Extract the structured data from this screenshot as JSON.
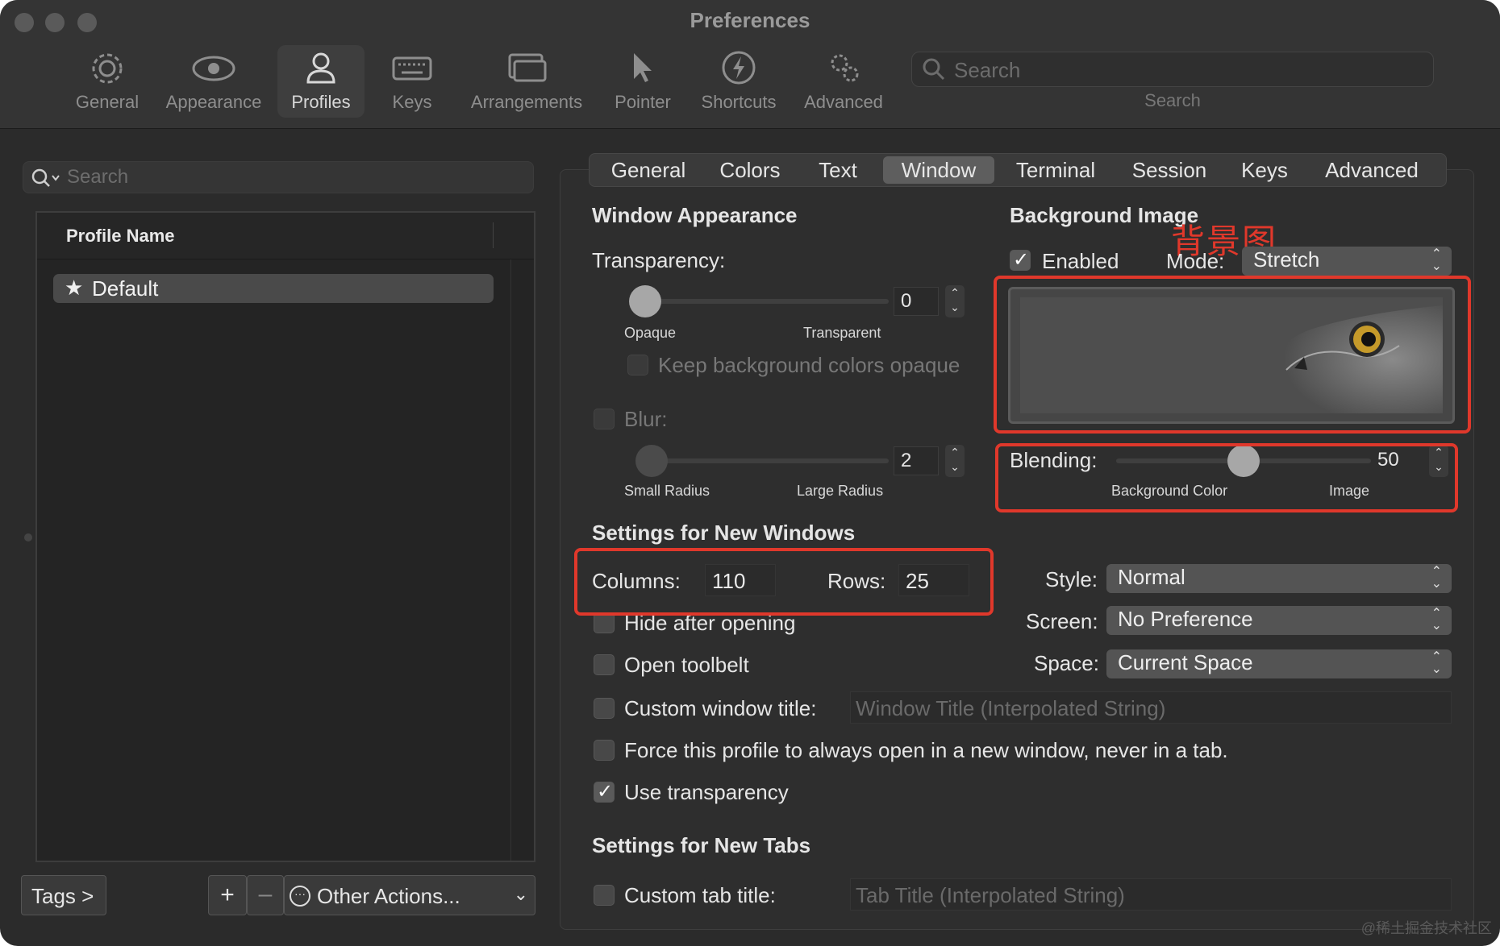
{
  "window": {
    "title": "Preferences"
  },
  "toolbar": {
    "items": [
      {
        "label": "General",
        "icon": "gear-icon"
      },
      {
        "label": "Appearance",
        "icon": "eye-icon"
      },
      {
        "label": "Profiles",
        "icon": "person-icon",
        "active": true
      },
      {
        "label": "Keys",
        "icon": "keyboard-icon"
      },
      {
        "label": "Arrangements",
        "icon": "windows-icon"
      },
      {
        "label": "Pointer",
        "icon": "pointer-icon"
      },
      {
        "label": "Shortcuts",
        "icon": "bolt-icon"
      },
      {
        "label": "Advanced",
        "icon": "gears-icon"
      }
    ],
    "search_placeholder": "Search",
    "search_label": "Search"
  },
  "profiles": {
    "search_placeholder": "Search",
    "column_header": "Profile Name",
    "items": [
      {
        "name": "Default",
        "icon": "star-icon",
        "selected": true
      }
    ],
    "tags_button": "Tags >",
    "add_button": "+",
    "remove_button": "–",
    "other_actions": "Other Actions..."
  },
  "tabs": [
    "General",
    "Colors",
    "Text",
    "Window",
    "Terminal",
    "Session",
    "Keys",
    "Advanced"
  ],
  "active_tab": "Window",
  "window_appearance": {
    "heading": "Window Appearance",
    "transparency_label": "Transparency:",
    "transparency_value": "0",
    "opaque_label": "Opaque",
    "transparent_label": "Transparent",
    "keep_opaque_label": "Keep background colors opaque",
    "blur_label": "Blur:",
    "blur_value": "2",
    "small_radius_label": "Small Radius",
    "large_radius_label": "Large Radius"
  },
  "background_image": {
    "heading": "Background Image",
    "enabled_label": "Enabled",
    "enabled": true,
    "mode_label": "Mode:",
    "mode_value": "Stretch",
    "preview_icon": "owl-image",
    "blending_label": "Blending:",
    "blending_value": "50",
    "blending_fraction": 0.5,
    "background_color_label": "Background Color",
    "image_label": "Image"
  },
  "new_windows": {
    "heading": "Settings for New Windows",
    "columns_label": "Columns:",
    "columns_value": "110",
    "rows_label": "Rows:",
    "rows_value": "25",
    "hide_after_opening": "Hide after opening",
    "open_toolbelt": "Open toolbelt",
    "custom_window_title": "Custom window title:",
    "window_title_placeholder": "Window Title (Interpolated String)",
    "force_new_window": "Force this profile to always open in a new window, never in a tab.",
    "use_transparency": "Use transparency",
    "use_transparency_checked": true,
    "style_label": "Style:",
    "style_value": "Normal",
    "screen_label": "Screen:",
    "screen_value": "No Preference",
    "space_label": "Space:",
    "space_value": "Current Space"
  },
  "new_tabs": {
    "heading": "Settings for New Tabs",
    "custom_tab_title": "Custom tab title:",
    "tab_title_placeholder": "Tab Title (Interpolated String)"
  },
  "annotation": {
    "text": "背景图",
    "color": "#e0382b"
  },
  "watermark": "@稀土掘金技术社区"
}
